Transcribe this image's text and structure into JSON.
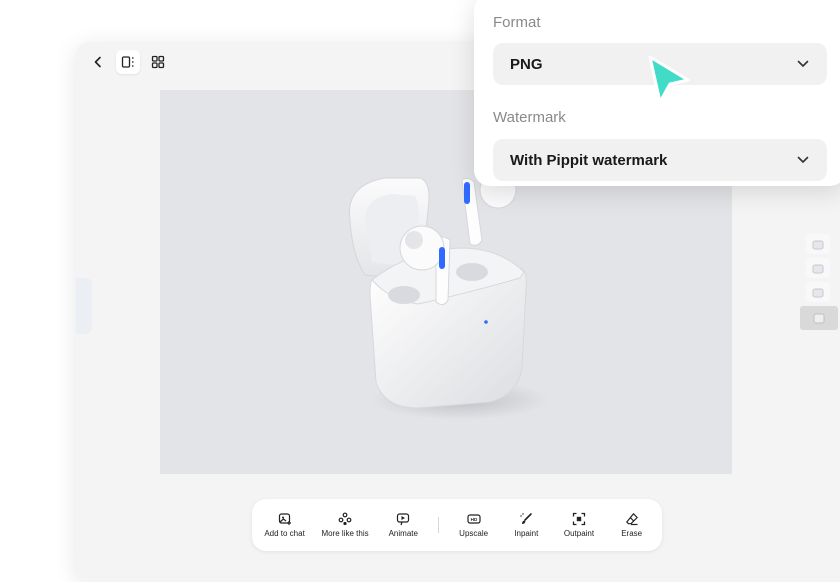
{
  "panel": {
    "format_label": "Format",
    "format_value": "PNG",
    "watermark_label": "Watermark",
    "watermark_value": "With Pippit watermark"
  },
  "topbar": {
    "icons": [
      "chevron-left-icon",
      "single-view-icon",
      "grid-view-icon"
    ]
  },
  "toolbar": {
    "items": [
      {
        "label": "Add to chat",
        "icon": "add-image-icon"
      },
      {
        "label": "More like this",
        "icon": "variations-icon"
      },
      {
        "label": "Animate",
        "icon": "animate-icon"
      },
      {
        "label": "Upscale",
        "icon": "hd-icon"
      },
      {
        "label": "Inpaint",
        "icon": "brush-icon"
      },
      {
        "label": "Outpaint",
        "icon": "expand-icon"
      },
      {
        "label": "Erase",
        "icon": "eraser-icon"
      }
    ]
  },
  "colors": {
    "cursor": "#41dcc7",
    "led": "#2f6bff",
    "canvas_bg": "#e3e4e7",
    "panel_bg": "#ffffff"
  }
}
